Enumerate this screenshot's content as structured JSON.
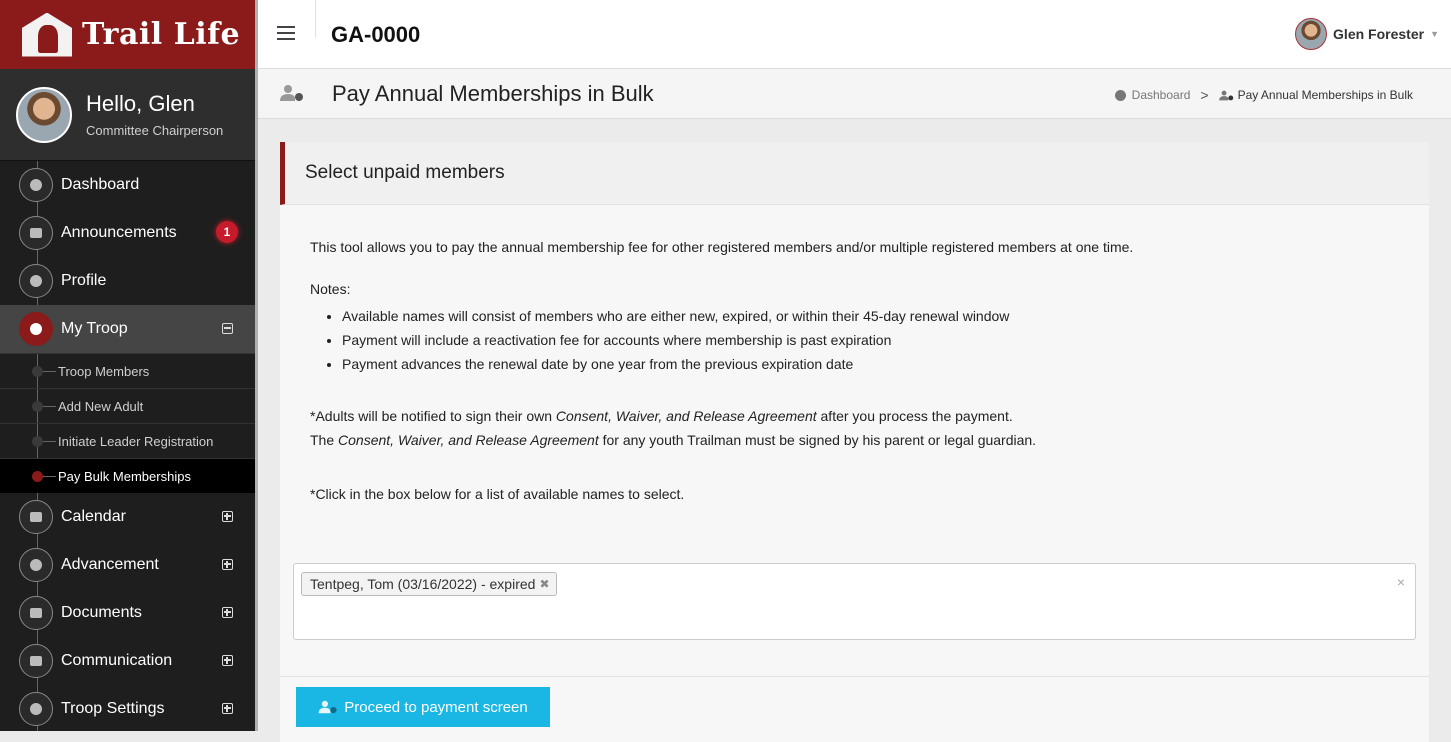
{
  "brand": {
    "name": "Trail Life"
  },
  "sidebar": {
    "user": {
      "greeting": "Hello, Glen",
      "role": "Committee Chairperson"
    },
    "items": [
      {
        "label": "Dashboard",
        "icon": "dashboard-icon"
      },
      {
        "label": "Announcements",
        "icon": "megaphone-icon",
        "badge": "1"
      },
      {
        "label": "Profile",
        "icon": "user-icon"
      },
      {
        "label": "My Troop",
        "icon": "group-icon",
        "expanded": true
      },
      {
        "label": "Calendar",
        "icon": "calendar-icon"
      },
      {
        "label": "Advancement",
        "icon": "hiker-icon"
      },
      {
        "label": "Documents",
        "icon": "document-icon"
      },
      {
        "label": "Communication",
        "icon": "envelope-icon"
      },
      {
        "label": "Troop Settings",
        "icon": "gears-icon"
      }
    ],
    "troop_sub": [
      "Troop Members",
      "Add New Adult",
      "Initiate Leader Registration",
      "Pay Bulk Memberships"
    ]
  },
  "topbar": {
    "unit": "GA-0000",
    "user_name": "Glen Forester"
  },
  "page": {
    "title": "Pay Annual Memberships in Bulk",
    "breadcrumb": [
      "Dashboard",
      "Pay Annual Memberships in Bulk"
    ]
  },
  "panel": {
    "title": "Select unpaid members",
    "intro": "This tool allows you to pay the annual membership fee for other registered members and/or multiple registered members at one time.",
    "notes_label": "Notes:",
    "notes": [
      "Available names will consist of members who are either new, expired, or within their 45-day renewal window",
      "Payment will include a reactivation fee for accounts where membership is past expiration",
      "Payment advances the renewal date by one year from the previous expiration date"
    ],
    "legal": {
      "l1_pre": "*Adults will be notified to sign their own ",
      "agreement": "Consent, Waiver, and Release Agreement",
      "l1_post": " after you process the payment.",
      "l2_pre": "The ",
      "l2_post": " for any youth Trailman must be signed by his parent or legal guardian."
    },
    "click_hint": "*Click in the box below for a list of available names to select.",
    "selected": [
      "Tentpeg, Tom (03/16/2022) - expired"
    ],
    "chip_remove": "✖",
    "clear_all": "×",
    "proceed_label": "Proceed to payment screen"
  },
  "colors": {
    "brand": "#8b1a1a",
    "button": "#1ab7e5",
    "sidebar": "#1e1e1e",
    "badge": "#c51b2a"
  }
}
